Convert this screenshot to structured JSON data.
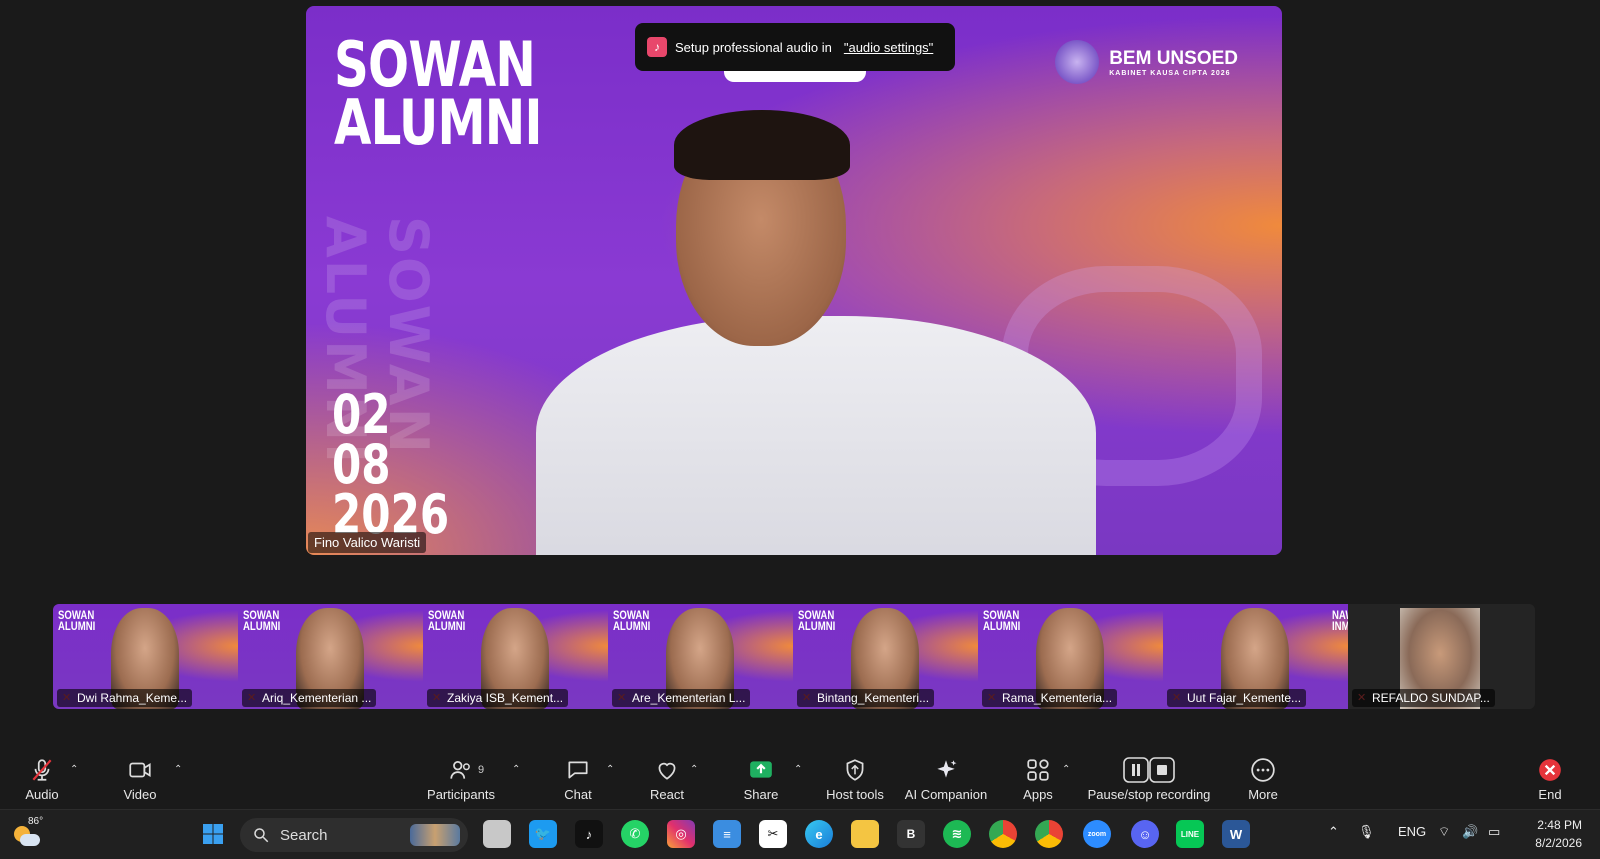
{
  "toast": {
    "text": "Setup professional audio in",
    "link": "\"audio settings\""
  },
  "speaker": {
    "title_line1": "SOWAN",
    "title_line2": "ALUMNI",
    "date_line1": "02",
    "date_line2": "08",
    "date_line3": "2026",
    "vertical_text": "SOWAN ALUMNI",
    "brand_name": "BEM UNSOED",
    "brand_sub": "KABINET KAUSA CIPTA 2026",
    "name": "Fino Valico Waristi"
  },
  "gallery": {
    "tiles": [
      {
        "name": "Dwi Rahma_Keme...",
        "title1": "SOWAN",
        "title2": "ALUMNI"
      },
      {
        "name": "Ariq_Kementerian ...",
        "title1": "SOWAN",
        "title2": "ALUMNI"
      },
      {
        "name": "Zakiya ISB_Kement...",
        "title1": "SOWAN",
        "title2": "ALUMNI"
      },
      {
        "name": "Are_Kementerian L...",
        "title1": "SOWAN",
        "title2": "ALUMNI"
      },
      {
        "name": "Bintang_Kementeri...",
        "title1": "SOWAN",
        "title2": "ALUMNI"
      },
      {
        "name": "Rama_Kementeria...",
        "title1": "SOWAN",
        "title2": "ALUMNI"
      },
      {
        "name": "Uut Fajar_Kemente...",
        "title1": "NAWOS",
        "title2": "INMUJA"
      },
      {
        "name": "REFALDO SUNDAP...",
        "title1": "",
        "title2": ""
      }
    ]
  },
  "toolbar": {
    "audio": "Audio",
    "video": "Video",
    "participants": "Participants",
    "participants_count": "9",
    "chat": "Chat",
    "react": "React",
    "share": "Share",
    "host_tools": "Host tools",
    "ai_companion": "AI Companion",
    "apps": "Apps",
    "recording": "Pause/stop recording",
    "more": "More",
    "end": "End"
  },
  "taskbar": {
    "temperature": "86°",
    "search": "Search",
    "lang": "ENG",
    "time": "2:48 PM",
    "date": "8/2/2026"
  },
  "colors": {
    "bg": "#1a1a1a",
    "share_green": "#1fb061",
    "end_red": "#e5343b",
    "purple": "#7b2ec9",
    "orange": "#f08a3c"
  }
}
